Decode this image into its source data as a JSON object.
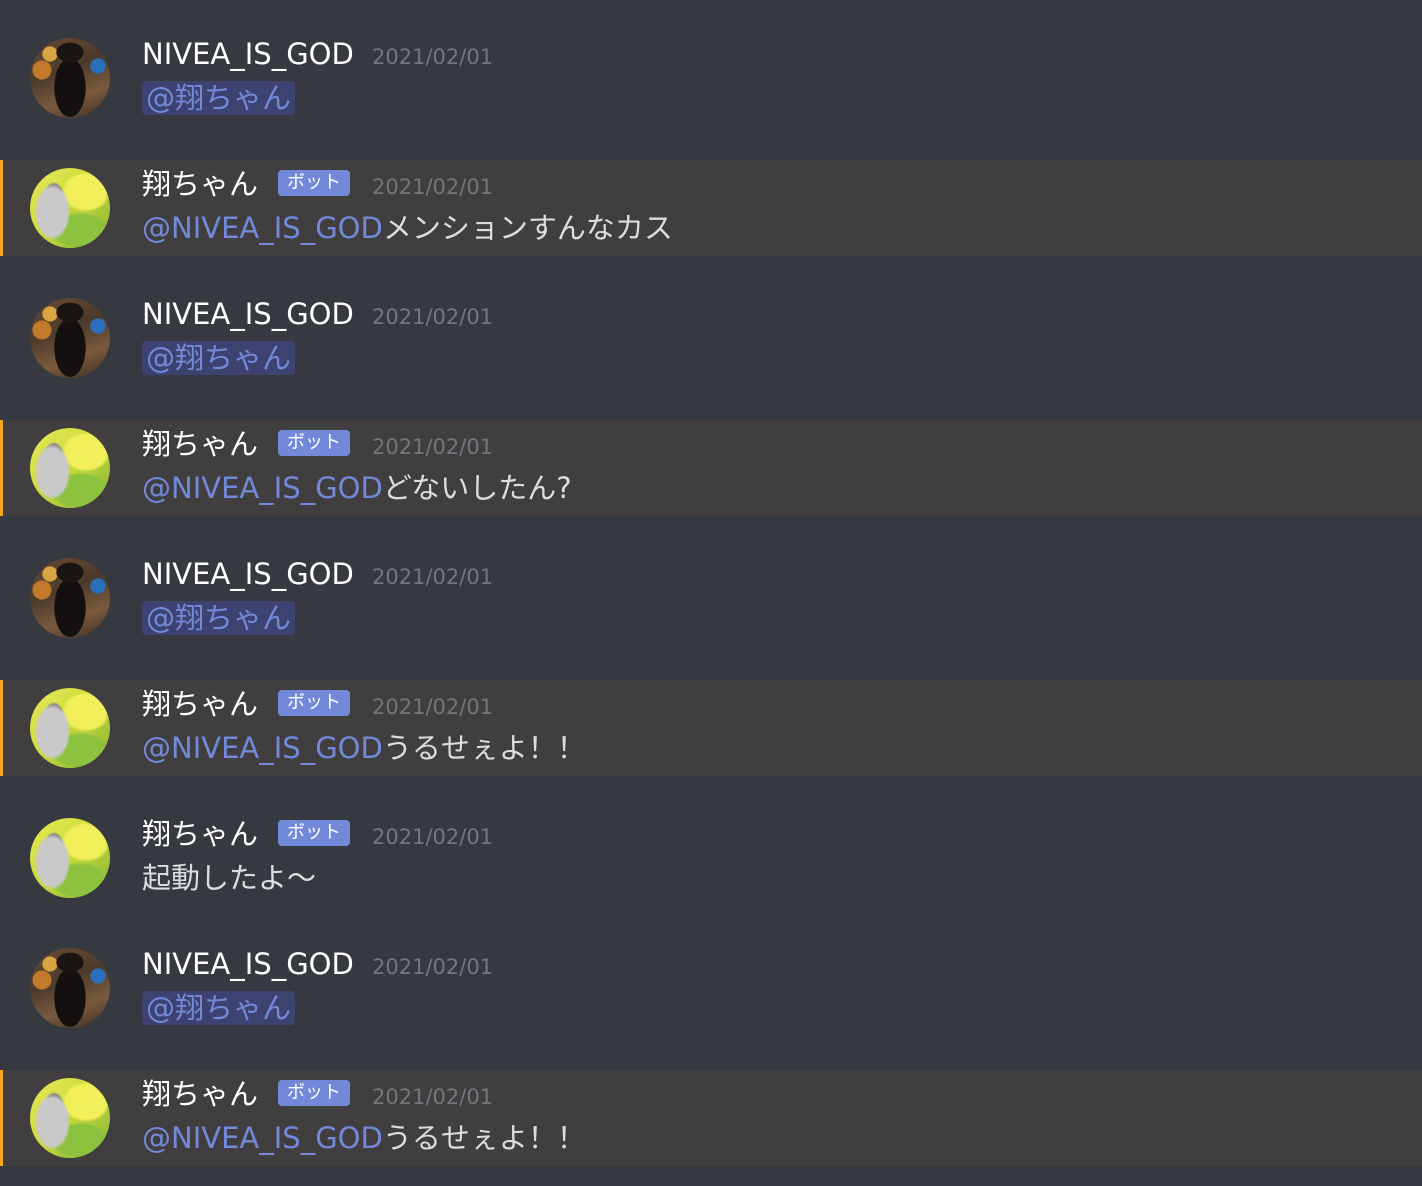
{
  "messages": [
    {
      "author": "NIVEA_IS_GOD",
      "is_bot": false,
      "timestamp": "2021/02/01",
      "mention": "@翔ちゃん",
      "text": ""
    },
    {
      "author": "翔ちゃん",
      "is_bot": true,
      "bot_badge": "ボット",
      "timestamp": "2021/02/01",
      "mention": "@NIVEA_IS_GOD",
      "text": "メンションすんなカス"
    },
    {
      "author": "NIVEA_IS_GOD",
      "is_bot": false,
      "timestamp": "2021/02/01",
      "mention": "@翔ちゃん",
      "text": ""
    },
    {
      "author": "翔ちゃん",
      "is_bot": true,
      "bot_badge": "ボット",
      "timestamp": "2021/02/01",
      "mention": "@NIVEA_IS_GOD",
      "text": "どないしたん?"
    },
    {
      "author": "NIVEA_IS_GOD",
      "is_bot": false,
      "timestamp": "2021/02/01",
      "mention": "@翔ちゃん",
      "text": ""
    },
    {
      "author": "翔ちゃん",
      "is_bot": true,
      "bot_badge": "ボット",
      "timestamp": "2021/02/01",
      "mention": "@NIVEA_IS_GOD",
      "text": "うるせぇよ！！"
    },
    {
      "author": "翔ちゃん",
      "is_bot": true,
      "bot_badge": "ボット",
      "timestamp": "2021/02/01",
      "mention": "",
      "text": "起動したよ〜"
    },
    {
      "author": "NIVEA_IS_GOD",
      "is_bot": false,
      "timestamp": "2021/02/01",
      "mention": "@翔ちゃん",
      "text": ""
    },
    {
      "author": "翔ちゃん",
      "is_bot": true,
      "bot_badge": "ボット",
      "timestamp": "2021/02/01",
      "mention": "@NIVEA_IS_GOD",
      "text": "うるせぇよ！！"
    }
  ],
  "colors": {
    "background": "#36393f",
    "highlight_background": "#403e3e",
    "highlight_border": "#faa61a",
    "mention": "#7289da",
    "bot_badge": "#7289da",
    "timestamp": "#72767d"
  }
}
